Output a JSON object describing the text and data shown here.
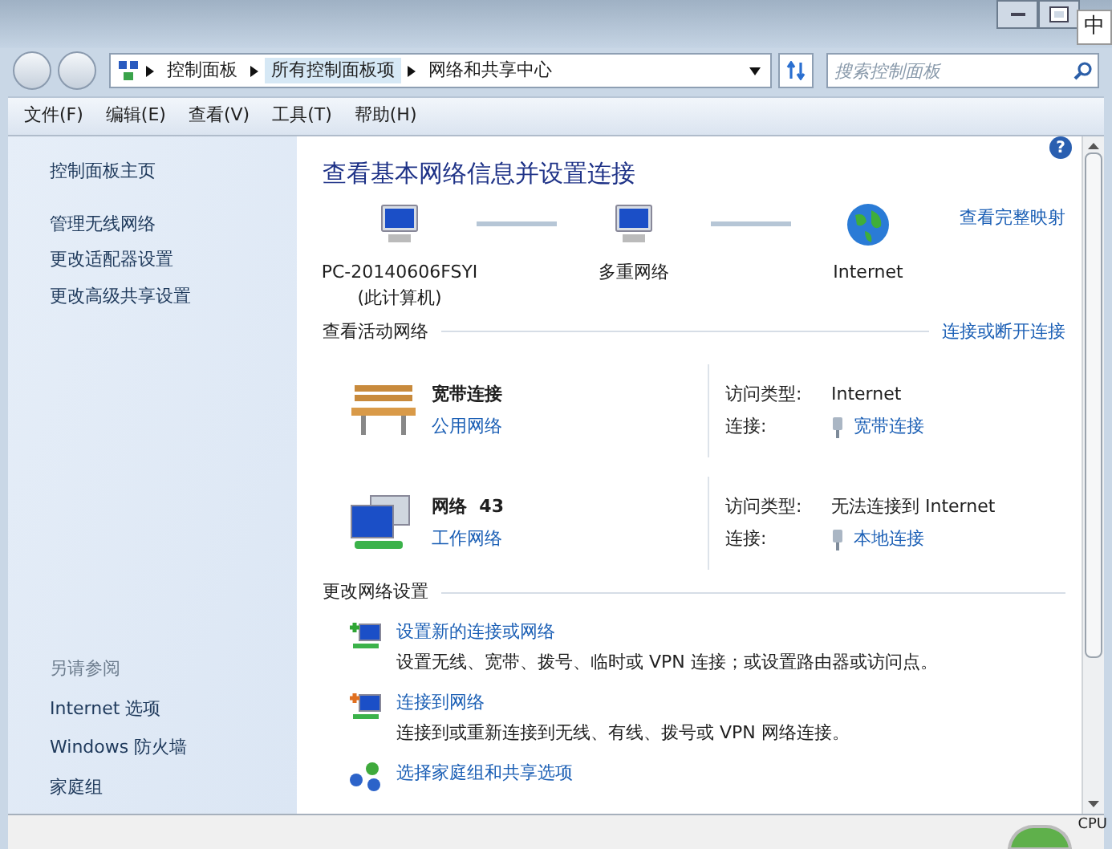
{
  "ime_indicator": "中",
  "address_bar": {
    "breadcrumbs": [
      {
        "label": "控制面板",
        "selected": false
      },
      {
        "label": "所有控制面板项",
        "selected": true
      },
      {
        "label": "网络和共享中心",
        "selected": false
      }
    ],
    "search": {
      "placeholder": "搜索控制面板"
    }
  },
  "menu_bar": [
    "文件(F)",
    "编辑(E)",
    "查看(V)",
    "工具(T)",
    "帮助(H)"
  ],
  "sidebar": {
    "items": [
      "控制面板主页",
      "管理无线网络",
      "更改适配器设置",
      "更改高级共享设置"
    ],
    "see_also": {
      "heading": "另请参阅",
      "items": [
        "Internet 选项",
        "Windows 防火墙",
        "家庭组"
      ]
    }
  },
  "main": {
    "title": "查看基本网络信息并设置连接",
    "map_link": "查看完整映射",
    "map_nodes": [
      {
        "kind": "computer",
        "label": "PC-20140606FSYI",
        "sublabel": "(此计算机)"
      },
      {
        "kind": "network",
        "label": "多重网络"
      },
      {
        "kind": "globe",
        "label": "Internet"
      }
    ],
    "active_networks": {
      "heading": "查看活动网络",
      "link": "连接或断开连接",
      "networks": [
        {
          "kind": "bench",
          "name": "宽带连接",
          "type": "公用网络",
          "access_label": "访问类型:",
          "access": "Internet",
          "connection_label": "连接:",
          "connection": "宽带连接"
        },
        {
          "kind": "computers",
          "name": "网络  43",
          "type": "工作网络",
          "access_label": "访问类型:",
          "access": "无法连接到 Internet",
          "connection_label": "连接:",
          "connection": "本地连接"
        }
      ]
    },
    "change_settings": {
      "heading": "更改网络设置",
      "tasks": [
        {
          "kind": "new",
          "title": "设置新的连接或网络",
          "description": "设置无线、宽带、拨号、临时或 VPN 连接；或设置路由器或访问点。"
        },
        {
          "kind": "connect",
          "title": "连接到网络",
          "description": "连接到或重新连接到无线、有线、拨号或 VPN 网络连接。"
        },
        {
          "kind": "homegroup",
          "title": "选择家庭组和共享选项"
        }
      ]
    }
  },
  "help_button": "?",
  "cpu_gadget": {
    "label": "CPU"
  }
}
